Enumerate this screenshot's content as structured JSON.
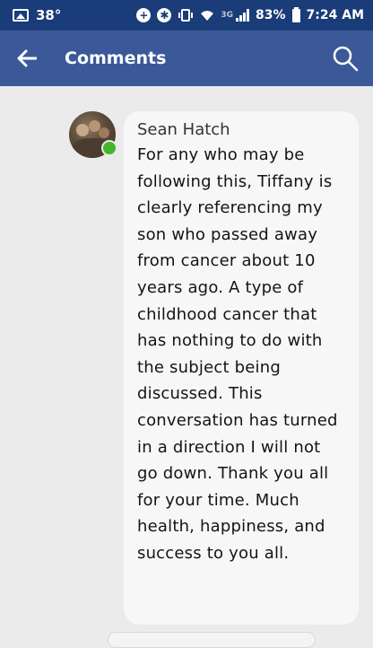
{
  "status_bar": {
    "temperature": "38°",
    "network_type": "3G",
    "battery": "83%",
    "time": "7:24 AM",
    "icons": [
      "gallery-icon",
      "data-saver-icon",
      "bluetooth-icon",
      "vibrate-icon",
      "wifi-icon",
      "signal-icon",
      "battery-icon"
    ]
  },
  "header": {
    "title": "Comments",
    "back_icon": "arrow-left-icon",
    "search_icon": "search-icon",
    "color": "#3b5998"
  },
  "comment": {
    "author": "Sean Hatch",
    "online": true,
    "text": "For any who may be following this, Tiffany is clearly referencing my son who passed away from cancer about 10 years ago. A type of childhood cancer that has nothing to do with the subject being discussed. This conversation has turned in a direction I will not go down. Thank you all for your time. Much health, happiness, and success to you all."
  }
}
